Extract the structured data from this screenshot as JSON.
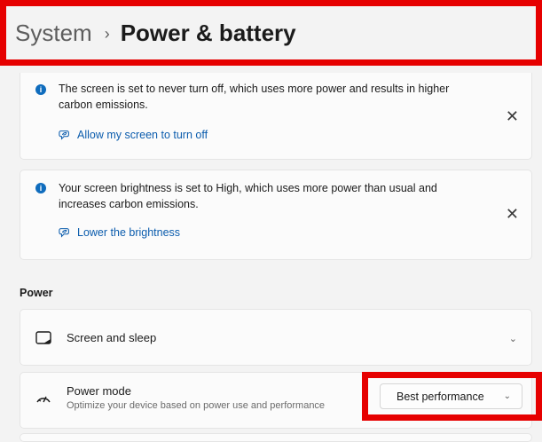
{
  "breadcrumb": {
    "parent": "System",
    "separator": "›",
    "current": "Power & battery"
  },
  "notices": [
    {
      "icon": "info-icon",
      "text": "The screen is set to never turn off, which uses more power and results in higher carbon emissions.",
      "link": "Allow my screen to turn off",
      "close": "✕"
    },
    {
      "icon": "info-icon",
      "text": "Your screen brightness is set to High, which uses more power than usual and increases carbon emissions.",
      "link": "Lower the brightness",
      "close": "✕"
    }
  ],
  "power": {
    "section_label": "Power",
    "screen_sleep": {
      "label": "Screen and sleep",
      "icon": "screen-sleep-icon"
    },
    "power_mode": {
      "label": "Power mode",
      "description": "Optimize your device based on power use and performance",
      "icon": "power-mode-icon",
      "selected": "Best performance"
    }
  },
  "colors": {
    "accent": "#0f6cbd",
    "highlight": "#e60000",
    "link": "#0b5cad"
  }
}
